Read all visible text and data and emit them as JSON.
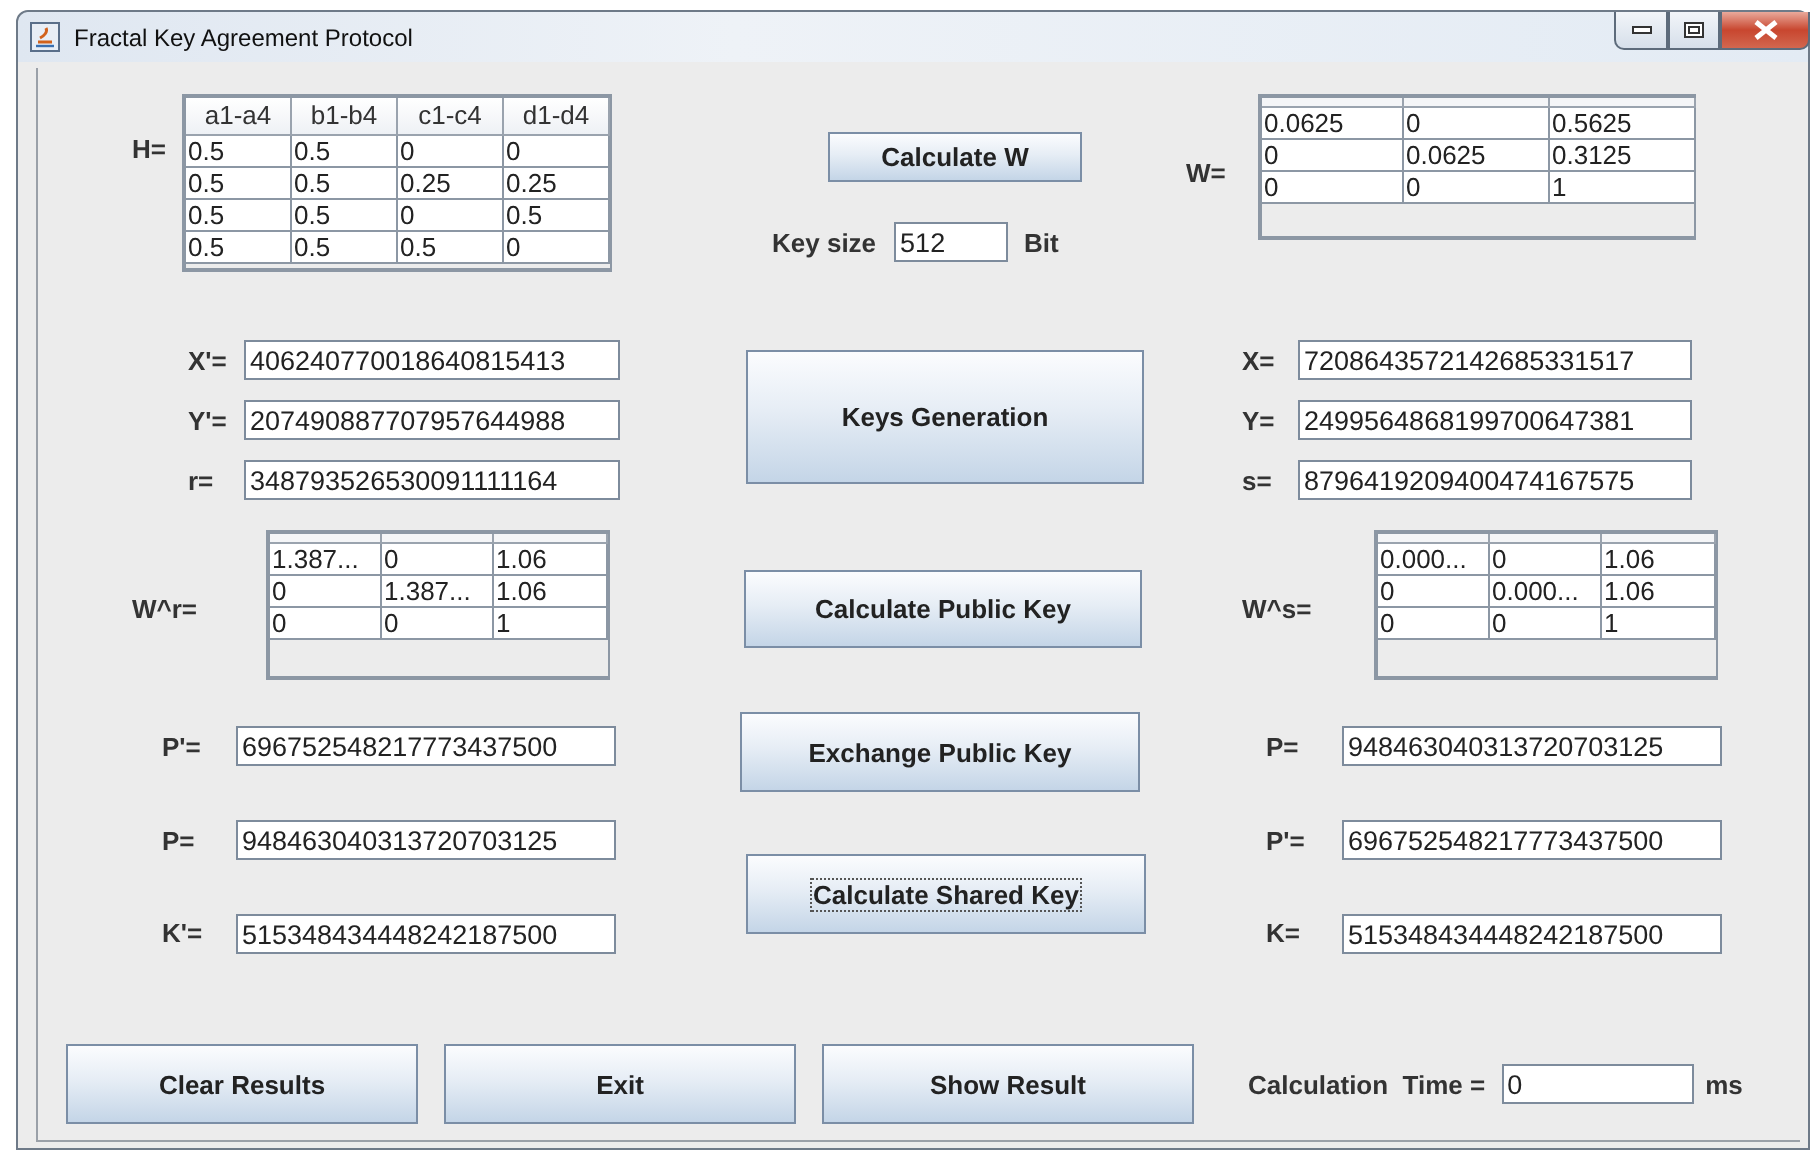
{
  "window": {
    "title": "Fractal Key Agreement Protocol"
  },
  "h_matrix": {
    "label": "H=",
    "columns": [
      "a1-a4",
      "b1-b4",
      "c1-c4",
      "d1-d4"
    ],
    "rows": [
      [
        "0.5",
        "0.5",
        "0",
        "0"
      ],
      [
        "0.5",
        "0.5",
        "0.25",
        "0.25"
      ],
      [
        "0.5",
        "0.5",
        "0",
        "0.5"
      ],
      [
        "0.5",
        "0.5",
        "0.5",
        "0"
      ]
    ]
  },
  "calculate_w_button": {
    "label": "Calculate W",
    "focused": false
  },
  "key_size": {
    "label": "Key size",
    "value": "512",
    "unit": "Bit"
  },
  "w_matrix": {
    "label": "W=",
    "rows": [
      [
        "0.0625",
        "0",
        "0.5625"
      ],
      [
        "0",
        "0.0625",
        "0.3125"
      ],
      [
        "0",
        "0",
        "1"
      ]
    ]
  },
  "left_keys": [
    {
      "label": "X'=",
      "value": "406240770018640815413"
    },
    {
      "label": "Y'=",
      "value": "207490887707957644988"
    },
    {
      "label": "r=",
      "value": "348793526530091111164"
    }
  ],
  "keys_generation_button": {
    "label": "Keys Generation",
    "focused": false
  },
  "right_keys": [
    {
      "label": "X=",
      "value": "7208643572142685331517"
    },
    {
      "label": "Y=",
      "value": "2499564868199700647381"
    },
    {
      "label": "s=",
      "value": "8796419209400474167575"
    }
  ],
  "wr_matrix": {
    "label": "W^r=",
    "rows": [
      [
        "1.387...",
        "0",
        "1.06"
      ],
      [
        "0",
        "1.387...",
        "1.06"
      ],
      [
        "0",
        "0",
        "1"
      ]
    ]
  },
  "calculate_public_key_button": {
    "label": "Calculate Public Key",
    "focused": false
  },
  "ws_matrix": {
    "label": "W^s=",
    "rows": [
      [
        "0.000...",
        "0",
        "1.06"
      ],
      [
        "0",
        "0.000...",
        "1.06"
      ],
      [
        "0",
        "0",
        "1"
      ]
    ]
  },
  "left_exchange": [
    {
      "label": "P'=",
      "value": "696752548217773437500"
    },
    {
      "label": "P=",
      "value": "948463040313720703125"
    },
    {
      "label": "K'=",
      "value": "515348434448242187500"
    }
  ],
  "center_buttons": [
    {
      "label": "Exchange Public Key",
      "focused": false
    },
    {
      "label": "Calculate Shared Key",
      "focused": true
    }
  ],
  "right_exchange": [
    {
      "label": "P=",
      "value": "948463040313720703125"
    },
    {
      "label": "P'=",
      "value": "696752548217773437500"
    },
    {
      "label": "K=",
      "value": "515348434448242187500"
    }
  ],
  "bottom_buttons": [
    {
      "label": "Clear Results",
      "focused": false
    },
    {
      "label": "Exit",
      "focused": false
    },
    {
      "label": "Show Result",
      "focused": false
    }
  ],
  "calculation_time": {
    "label": "Calculation  Time =",
    "value": "0",
    "unit": "ms"
  }
}
